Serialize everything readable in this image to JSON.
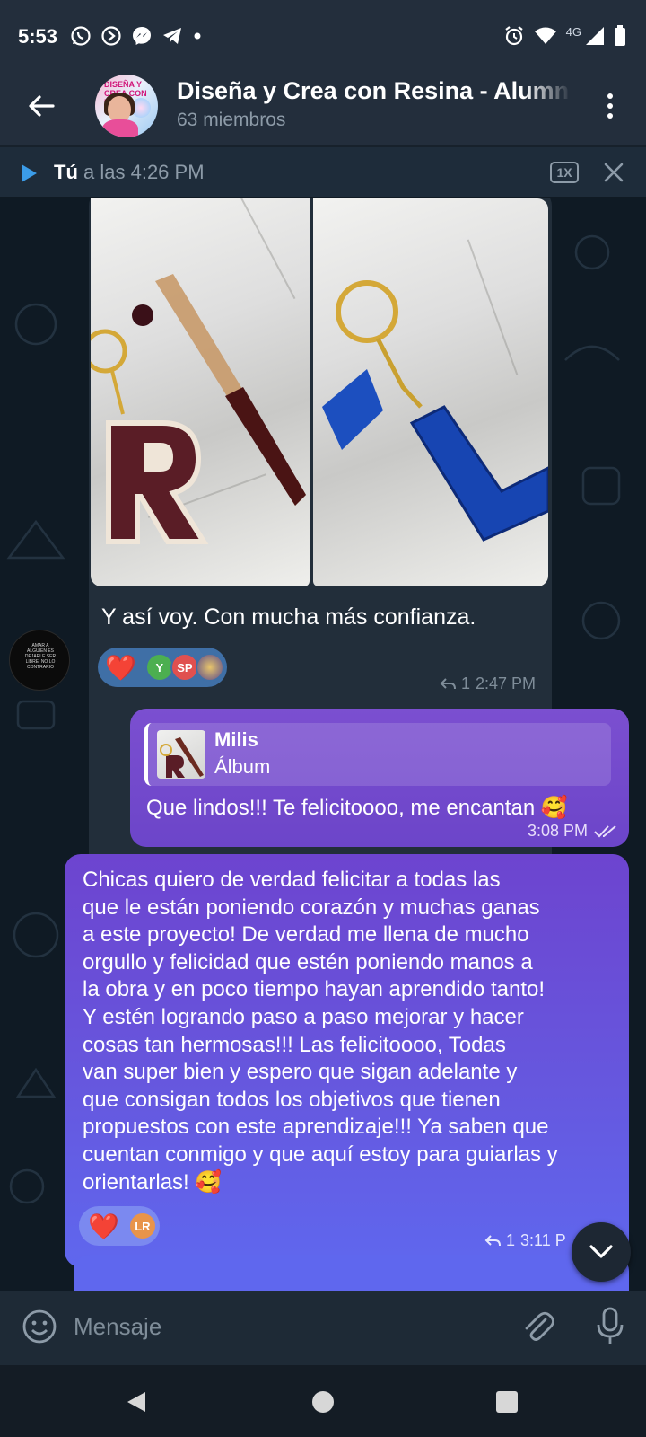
{
  "status_bar": {
    "time": "5:53",
    "network": "4G"
  },
  "header": {
    "title": "Diseña y Crea con Resina - Alumn",
    "subtitle": "63 miembros",
    "avatar_text": "DISEÑA Y CREA CON RESINA"
  },
  "player": {
    "sender": "Tú",
    "time_text": "a las 4:26 PM",
    "speed": "1X"
  },
  "messages": {
    "album": {
      "caption": "Y así voy. Con mucha más confianza.",
      "reactions": [
        {
          "emoji": "❤️"
        },
        {
          "initials": "Y",
          "color": "#4caf50"
        },
        {
          "initials": "SP",
          "color": "#e0504f"
        },
        {
          "initials": "",
          "color": "#6a5b8c"
        }
      ],
      "replies": "1",
      "time": "2:47 PM"
    },
    "reply": {
      "quoted_name": "Milis",
      "quoted_text": "Álbum",
      "text": "Que lindos!!! Te felicitoooo, me encantan 🥰",
      "time": "3:08 PM"
    },
    "long": {
      "lines": [
        "Chicas quiero de verdad felicitar a todas las",
        "que le están poniendo corazón y muchas ganas",
        "a este proyecto! De verdad me llena de mucho",
        "orgullo y felicidad que estén poniendo manos a",
        "la obra y en poco tiempo hayan aprendido tanto!",
        "Y estén logrando paso a paso mejorar y hacer",
        "cosas tan hermosas!!! Las felicitoooo, Todas",
        "van super bien y espero que sigan adelante y",
        "que consigan todos los objetivos que tienen",
        "propuestos con este aprendizaje!!! Ya saben que",
        "cuentan conmigo y que aquí estoy para guiarlas y",
        "orientarlas! 🥰"
      ],
      "reactions": [
        {
          "emoji": "❤️"
        },
        {
          "initials": "LR",
          "color": "#e8944a"
        }
      ],
      "replies": "1",
      "time": "3:11 P"
    }
  },
  "input": {
    "placeholder": "Mensaje"
  }
}
